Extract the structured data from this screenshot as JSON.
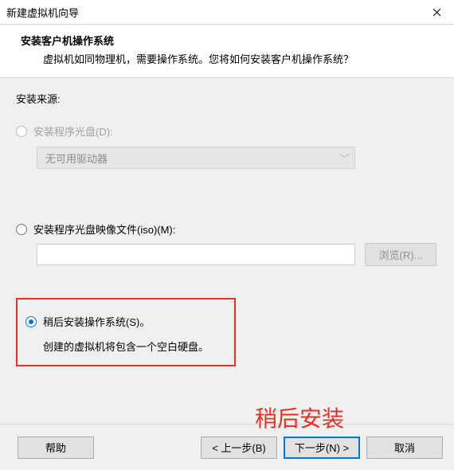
{
  "window": {
    "title": "新建虚拟机向导"
  },
  "header": {
    "title": "安装客户机操作系统",
    "subtitle": "虚拟机如同物理机，需要操作系统。您将如何安装客户机操作系统？"
  },
  "source": {
    "label": "安装来源:"
  },
  "opt_disc": {
    "label": "安装程序光盘(D):",
    "dropdown": "无可用驱动器"
  },
  "opt_iso": {
    "label": "安装程序光盘映像文件(iso)(M):",
    "path": "",
    "browse": "浏览(R)..."
  },
  "opt_later": {
    "label": "稍后安装操作系统(S)。",
    "desc": "创建的虚拟机将包含一个空白硬盘。"
  },
  "annotation": "稍后安装",
  "buttons": {
    "help": "帮助",
    "back": "< 上一步(B)",
    "next": "下一步(N) >",
    "cancel": "取消"
  }
}
